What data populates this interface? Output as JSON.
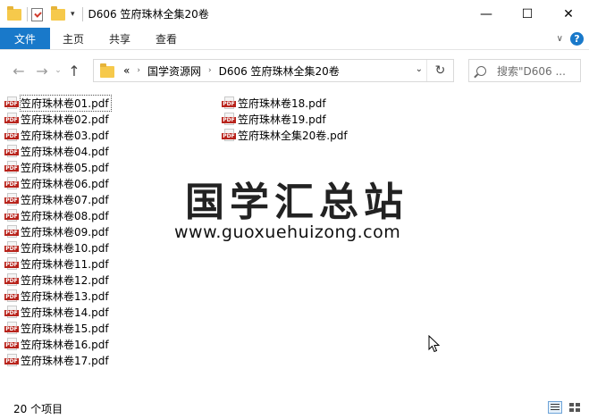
{
  "window": {
    "title": "D606 笠府珠林全集20卷",
    "controls": {
      "minimize": "—",
      "maximize": "☐",
      "close": "✕"
    }
  },
  "ribbon": {
    "tabs": [
      {
        "label": "文件",
        "active": true
      },
      {
        "label": "主页"
      },
      {
        "label": "共享"
      },
      {
        "label": "查看"
      }
    ],
    "help": "?"
  },
  "navigation": {
    "back": "←",
    "forward": "→",
    "recent": "⌄",
    "up": "↑",
    "breadcrumb": {
      "overflow": "«",
      "items": [
        "国学资源网",
        "D606 笠府珠林全集20卷"
      ]
    },
    "refresh": "↻",
    "search_placeholder": "搜索\"D606 ..."
  },
  "files": {
    "icon": "pdf-icon",
    "icon_tag": "PDF",
    "column1": [
      "笠府珠林卷01.pdf",
      "笠府珠林卷02.pdf",
      "笠府珠林卷03.pdf",
      "笠府珠林卷04.pdf",
      "笠府珠林卷05.pdf",
      "笠府珠林卷06.pdf",
      "笠府珠林卷07.pdf",
      "笠府珠林卷08.pdf",
      "笠府珠林卷09.pdf",
      "笠府珠林卷10.pdf",
      "笠府珠林卷11.pdf",
      "笠府珠林卷12.pdf",
      "笠府珠林卷13.pdf",
      "笠府珠林卷14.pdf",
      "笠府珠林卷15.pdf",
      "笠府珠林卷16.pdf",
      "笠府珠林卷17.pdf"
    ],
    "column2": [
      "笠府珠林卷18.pdf",
      "笠府珠林卷19.pdf",
      "笠府珠林全集20卷.pdf"
    ]
  },
  "watermark": {
    "title": "国学汇总站",
    "url": "www.guoxuehuizong.com"
  },
  "status": {
    "count_text": "20 个项目"
  },
  "colors": {
    "accent": "#1979ca",
    "folder": "#f6c94b",
    "pdf_red": "#b8231b"
  }
}
